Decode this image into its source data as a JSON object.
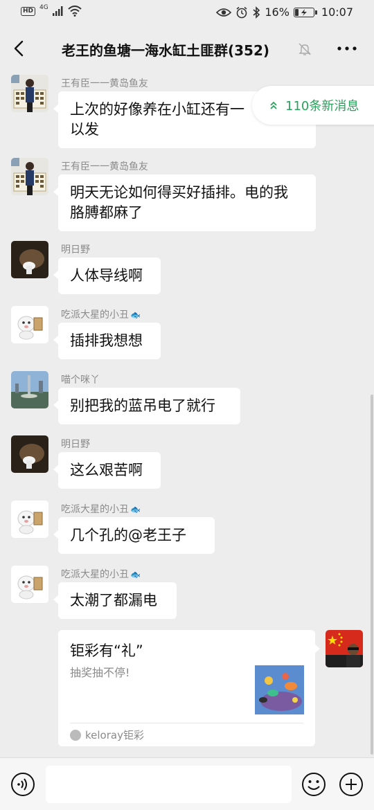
{
  "status_bar": {
    "left_badges": "HD",
    "network": "4G",
    "battery_percent": "16%",
    "time": "10:07",
    "icons": [
      "eye-icon",
      "alarm-icon",
      "bluetooth-icon",
      "battery-icon"
    ]
  },
  "header": {
    "title": "老王的鱼塘一海水缸土匪群(352)",
    "icons": [
      "back-arrow-icon",
      "mute-bell-icon",
      "more-icon"
    ]
  },
  "new_messages_banner": "110条新消息",
  "messages": [
    {
      "sender": "王有臣一一黄岛鱼友",
      "text": "上次的好像养在小缸还有一\n以发",
      "avatar": "person-avatar"
    },
    {
      "sender": "王有臣一一黄岛鱼友",
      "text": "明天无论如何得买好插排。电的我\n胳膊都麻了",
      "avatar": "person-avatar"
    },
    {
      "sender": "明日野",
      "text": "人体导线啊",
      "avatar": "dark-avatar"
    },
    {
      "sender": "吃派大星的小丑",
      "text": "插排我想想",
      "avatar": "cartoon-avatar"
    },
    {
      "sender": "喵个咪丫",
      "text": "别把我的蓝吊电了就行",
      "avatar": "city-avatar"
    },
    {
      "sender": "明日野",
      "text": "这么艰苦啊",
      "avatar": "dark-avatar"
    },
    {
      "sender": "吃派大星的小丑",
      "text": "几个孔的@老王子",
      "avatar": "cartoon-avatar"
    },
    {
      "sender": "吃派大星的小丑",
      "text": "太潮了都漏电",
      "avatar": "cartoon-avatar"
    }
  ],
  "card": {
    "title": "钜彩有“礼”",
    "description": "抽奖抽不停!",
    "source": "keloray钜彩"
  },
  "input_bar": {
    "icons": [
      "voice-icon",
      "emoji-icon",
      "plus-icon"
    ]
  },
  "colors": {
    "background": "#ededed",
    "bubble": "#ffffff",
    "accent_green": "#27a35a",
    "nickname": "#8a8a8a"
  }
}
